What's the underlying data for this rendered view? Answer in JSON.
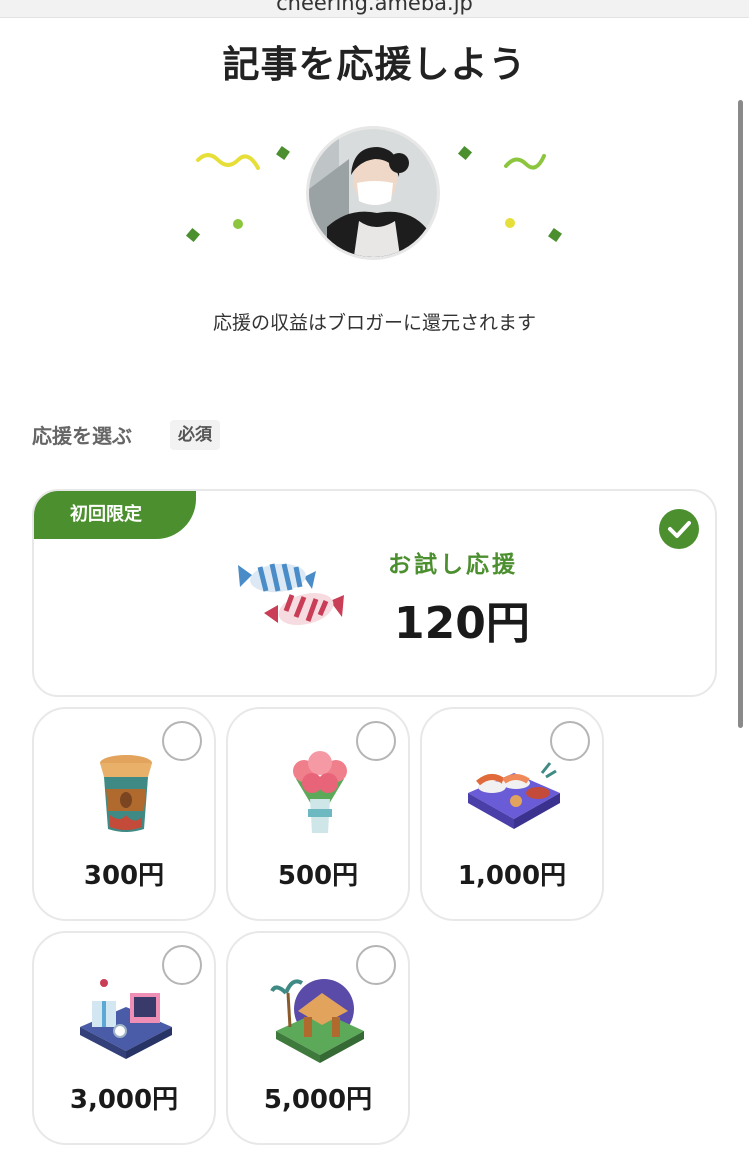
{
  "browser": {
    "url": "cheering.ameba.jp"
  },
  "page": {
    "title": "記事を応援しよう"
  },
  "hero": {
    "note": "応援の収益はブロガーに還元されます"
  },
  "select_section": {
    "label": "応援を選ぶ",
    "required_badge": "必須"
  },
  "main_option": {
    "badge": "初回限定",
    "name": "お試し応援",
    "price": "120円",
    "selected": true,
    "icon": "candy-icon"
  },
  "options": [
    {
      "price": "300円",
      "icon": "coffee-cup-icon",
      "selected": false
    },
    {
      "price": "500円",
      "icon": "bouquet-icon",
      "selected": false
    },
    {
      "price": "1,000円",
      "icon": "sushi-platter-icon",
      "selected": false
    },
    {
      "price": "3,000円",
      "icon": "gift-desk-icon",
      "selected": false
    },
    {
      "price": "5,000円",
      "icon": "island-resort-icon",
      "selected": false
    }
  ],
  "colors": {
    "accent": "#4c8f2f",
    "confetti_yellow": "#e6df3a",
    "confetti_green": "#8cc63f"
  }
}
